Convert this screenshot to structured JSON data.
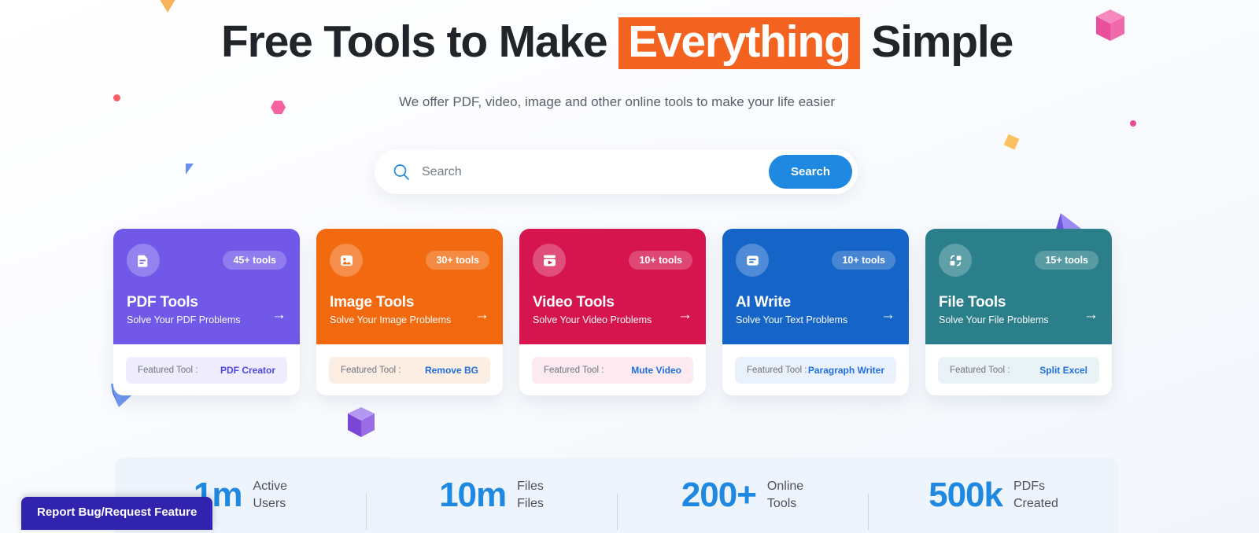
{
  "hero": {
    "headline_part1": "Free Tools to Make",
    "headline_highlight": "Everything",
    "headline_part2": "Simple",
    "subtitle": "We offer PDF, video, image and other online tools to make your life easier"
  },
  "search": {
    "placeholder": "Search",
    "value": "",
    "button_label": "Search",
    "icon": "search-icon"
  },
  "cards": [
    {
      "title": "PDF Tools",
      "subtitle": "Solve Your PDF Problems",
      "badge": "45+ tools",
      "featured_label": "Featured Tool :",
      "featured_tool": "PDF Creator",
      "arrow": "→",
      "icon": "document-icon",
      "color": "#7158e8",
      "foot_bg": "#efecfd",
      "link_color": "#4f46e5"
    },
    {
      "title": "Image Tools",
      "subtitle": "Solve Your Image Problems",
      "badge": "30+ tools",
      "featured_label": "Featured Tool :",
      "featured_tool": "Remove BG",
      "arrow": "→",
      "icon": "image-icon",
      "color": "#f2690f",
      "foot_bg": "#fdeee3",
      "link_color": "#1f6fe0"
    },
    {
      "title": "Video Tools",
      "subtitle": "Solve Your Video Problems",
      "badge": "10+ tools",
      "featured_label": "Featured Tool :",
      "featured_tool": "Mute Video",
      "arrow": "→",
      "icon": "video-icon",
      "color": "#d6154f",
      "foot_bg": "#fdeaf0",
      "link_color": "#1f6fe0"
    },
    {
      "title": "AI Write",
      "subtitle": "Solve Your Text Problems",
      "badge": "10+ tools",
      "featured_label": "Featured Tool :",
      "featured_tool": "Paragraph Writer",
      "arrow": "→",
      "icon": "text-lines-icon",
      "color": "#1565c8",
      "foot_bg": "#e9f1fc",
      "link_color": "#1f6fe0"
    },
    {
      "title": "File Tools",
      "subtitle": "Solve Your File Problems",
      "badge": "15+ tools",
      "featured_label": "Featured Tool :",
      "featured_tool": "Split Excel",
      "arrow": "→",
      "icon": "file-convert-icon",
      "color": "#2a7f8a",
      "foot_bg": "#e9f3f5",
      "link_color": "#1f6fe0"
    }
  ],
  "stats": [
    {
      "number": "1m",
      "label_line1": "Active",
      "label_line2": "Users"
    },
    {
      "number": "10m",
      "label_line1": "Files",
      "label_line2": "Files"
    },
    {
      "number": "200+",
      "label_line1": "Online",
      "label_line2": "Tools"
    },
    {
      "number": "500k",
      "label_line1": "PDFs",
      "label_line2": "Created"
    }
  ],
  "report_badge": {
    "label": "Report Bug/Request Feature"
  },
  "colors": {
    "accent_blue": "#1f88e0",
    "highlight_orange": "#f4621f",
    "badge_purple": "#3023ae",
    "stats_bg": "#eef4fc"
  }
}
